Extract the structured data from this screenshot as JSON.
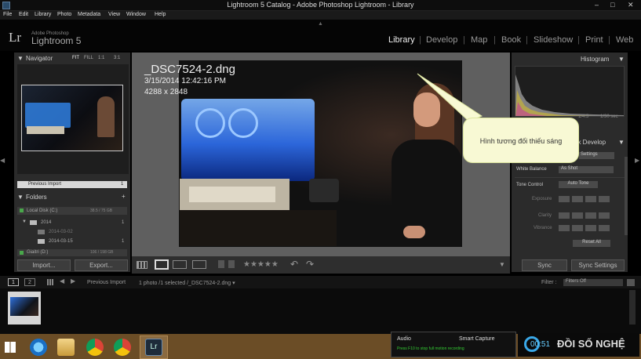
{
  "window": {
    "title": "Lightroom 5 Catalog - Adobe Photoshop Lightroom - Library",
    "minimize": "–",
    "maximize": "□",
    "close": "✕"
  },
  "menu": [
    "File",
    "Edit",
    "Library",
    "Photo",
    "Metadata",
    "View",
    "Window",
    "Help"
  ],
  "brand": {
    "mark": "Lr",
    "small": "Adobe Photoshop",
    "name": "Lightroom 5"
  },
  "modules": [
    "Library",
    "Develop",
    "Map",
    "Book",
    "Slideshow",
    "Print",
    "Web"
  ],
  "navigator": {
    "title": "Navigator",
    "zoom": [
      "FIT",
      "FILL",
      "1:1",
      "3:1"
    ]
  },
  "catalog": {
    "item": "Previous Import",
    "count": "1"
  },
  "folders": {
    "title": "Folders",
    "add": "+",
    "volumes": [
      {
        "name": "Local Disk (C:)",
        "size": "38.5 / 75 GB"
      },
      {
        "name": "Giaitri (D:)",
        "size": "106 / 198 GB"
      }
    ],
    "items": [
      {
        "name": "2014",
        "count": "1"
      },
      {
        "name": "2014-03-02",
        "count": ""
      },
      {
        "name": "2014-03-15",
        "count": "1"
      }
    ]
  },
  "left_buttons": {
    "import": "Import...",
    "export": "Export..."
  },
  "photo_info": {
    "filename": "_DSC7524-2.dng",
    "datetime": "3/15/2014 12:42:16 PM",
    "dimensions": "4288 x 2848"
  },
  "toolbar": {
    "stars": "★★★★★"
  },
  "histogram": {
    "title": "Histogram",
    "info": "1/4.5",
    "shutter": "1/30 sec"
  },
  "quick_develop": {
    "title": "Quick Develop",
    "saved_preset": "Settings",
    "white_balance_label": "White Balance",
    "white_balance_value": "As Shot",
    "tone_control_label": "Tone Control",
    "auto_tone": "Auto Tone",
    "sliders": [
      "Exposure",
      "Clarity",
      "Vibrance"
    ],
    "reset": "Reset All"
  },
  "right_buttons": {
    "sync": "Sync",
    "sync_settings": "Sync Settings"
  },
  "filmstrip": {
    "page1": "1",
    "page2": "2",
    "source": "Previous Import",
    "status": "1 photo /1 selected /_DSC7524-2.dng ▾",
    "filter_label": "Filter :",
    "filter_value": "Filters Off"
  },
  "callout": {
    "text": "Hình tương đối thiếu sáng"
  },
  "recorder": {
    "audio": "Audio",
    "smart_capture": "Smart Capture",
    "hint": "Press F10 to stop full motion recording"
  },
  "overlay_brand": {
    "text": "ĐỒI SỐ NGHỆ",
    "time": "00:51"
  },
  "colors": {
    "accent": "#dddddd",
    "background": "#000000",
    "panel": "#2b2b2b",
    "center": "#5f5f5f",
    "taskbar": "#6b4d26"
  },
  "icons": [
    "lightroom-app-icon",
    "ie-icon",
    "explorer-icon",
    "chrome-icon",
    "chrome-icon",
    "lightroom-taskbar-icon",
    "windows-start-icon"
  ]
}
